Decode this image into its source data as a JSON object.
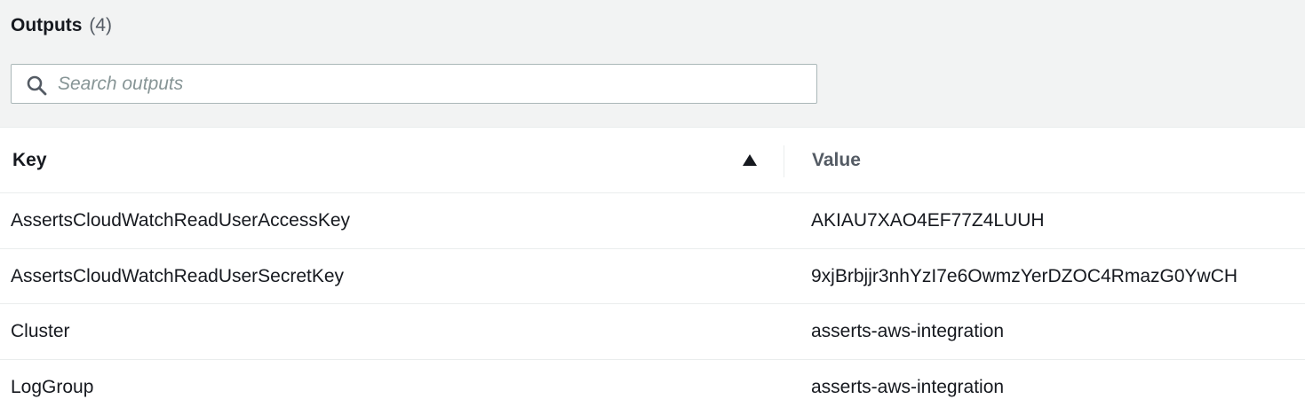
{
  "header": {
    "title": "Outputs",
    "count": "(4)"
  },
  "search": {
    "placeholder": "Search outputs",
    "value": "",
    "icon": "search-icon"
  },
  "table": {
    "columns": {
      "key": "Key",
      "value": "Value"
    },
    "sort": {
      "column": "Key",
      "direction": "ascending",
      "icon": "sort-ascending-icon"
    },
    "rows": [
      {
        "key": "AssertsCloudWatchReadUserAccessKey",
        "value": "AKIAU7XAO4EF77Z4LUUH"
      },
      {
        "key": "AssertsCloudWatchReadUserSecretKey",
        "value": "9xjBrbjjr3nhYzI7e6OwmzYerDZOC4RmazG0YwCH"
      },
      {
        "key": "Cluster",
        "value": "asserts-aws-integration"
      },
      {
        "key": "LogGroup",
        "value": "asserts-aws-integration"
      }
    ]
  },
  "colors": {
    "panel_background": "#f2f3f3",
    "text": "#16191f",
    "muted_text": "#545b64",
    "border": "#aab7b8"
  }
}
